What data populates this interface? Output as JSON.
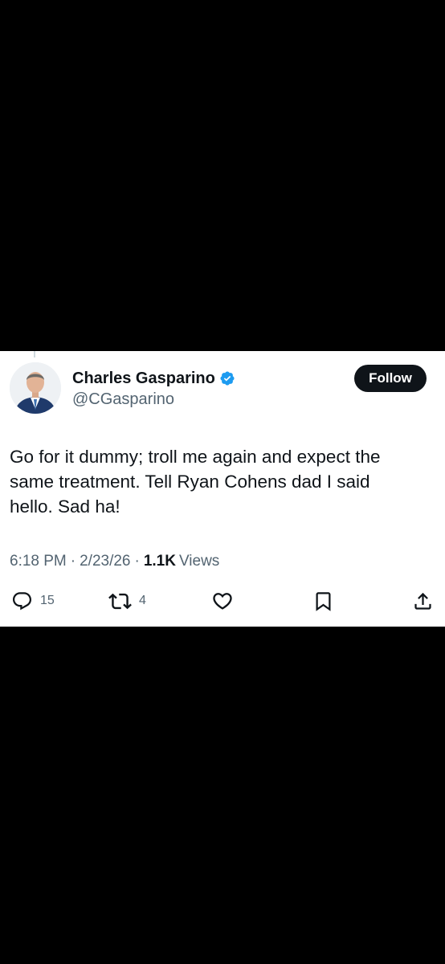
{
  "tweet": {
    "author": {
      "display_name": "Charles Gasparino",
      "handle": "@CGasparino",
      "verified": true,
      "verified_color": "#1d9bf0",
      "avatar": "profile-photo"
    },
    "follow_label": "Follow",
    "text_lines": [
      "Go for it dummy; troll me again and expect the",
      "same treatment. Tell Ryan Cohens dad I said",
      "hello. Sad ha!"
    ],
    "time": "6:18 PM",
    "separator": "·",
    "date": "2/23/26",
    "views_count": "1.1K",
    "views_label": "Views",
    "actions": {
      "reply": {
        "icon": "reply-icon",
        "count": "15"
      },
      "repost": {
        "icon": "repost-icon",
        "count": "4"
      },
      "like": {
        "icon": "heart-icon"
      },
      "bookmark": {
        "icon": "bookmark-icon"
      },
      "share": {
        "icon": "share-icon"
      }
    }
  },
  "colors": {
    "background": "#000000",
    "card": "#ffffff",
    "text_primary": "#0f1419",
    "text_secondary": "#536471",
    "follow_button_bg": "#0f1419"
  }
}
